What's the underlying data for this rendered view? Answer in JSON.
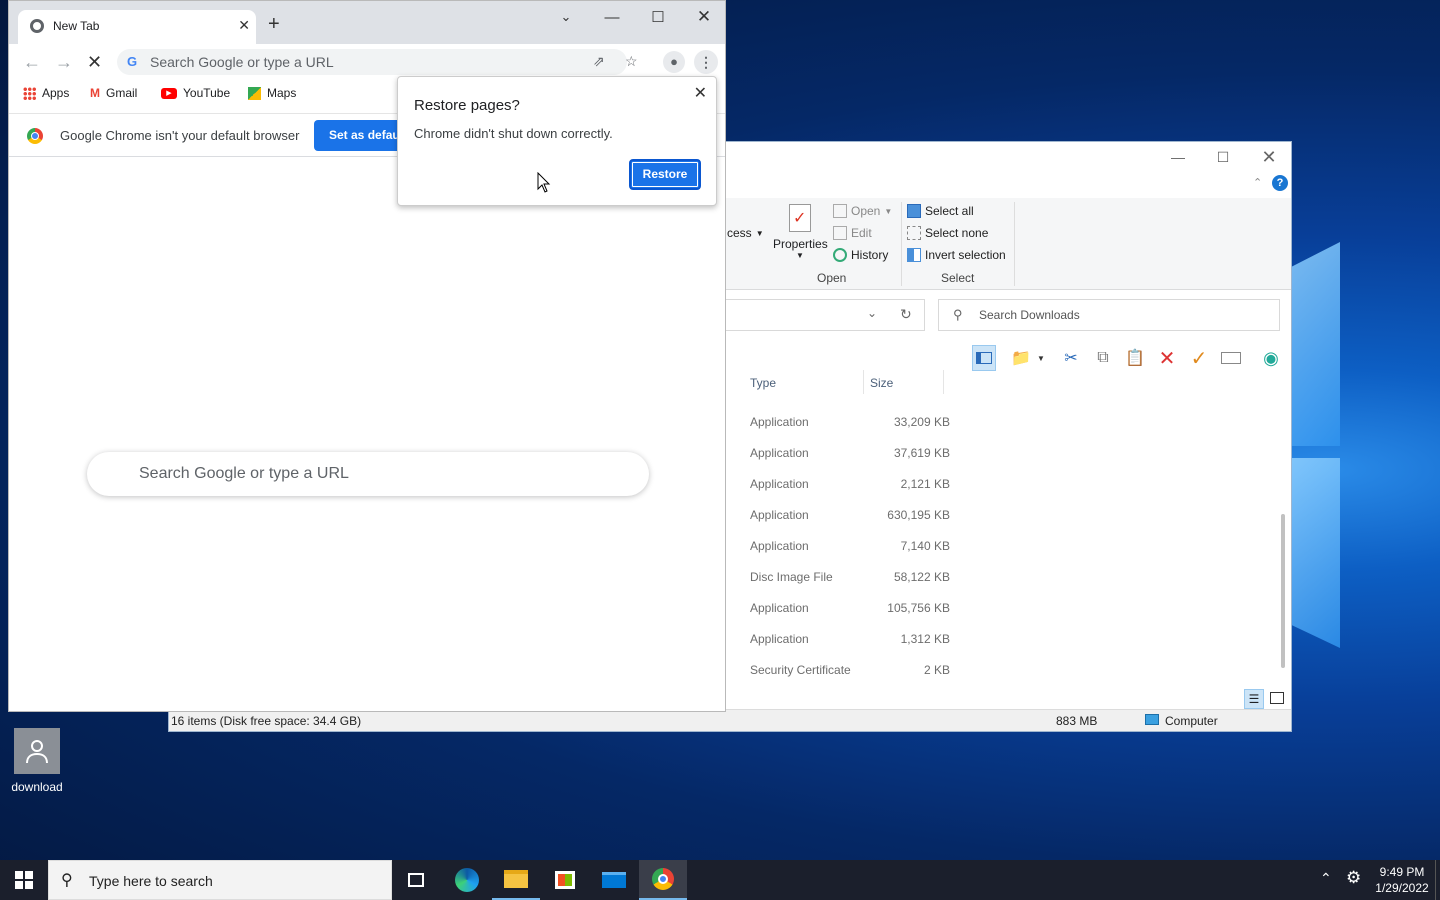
{
  "desktop": {
    "icon_label": "download"
  },
  "chrome": {
    "tab_title": "New Tab",
    "omnibox_placeholder": "Search Google or type a URL",
    "bookmarks": [
      "Apps",
      "Gmail",
      "YouTube",
      "Maps"
    ],
    "infobar_message": "Google Chrome isn't your default browser",
    "infobar_button": "Set as default",
    "ntp_search_placeholder": "Search Google or type a URL",
    "restore_dialog": {
      "title": "Restore pages?",
      "message": "Chrome didn't shut down correctly.",
      "button": "Restore"
    }
  },
  "explorer": {
    "ribbon": {
      "partial_access_label": "cess",
      "properties_label": "Properties",
      "open_label": "Open",
      "edit_label": "Edit",
      "history_label": "History",
      "open_group_label": "Open",
      "select_all_label": "Select all",
      "select_none_label": "Select none",
      "invert_selection_label": "Invert selection",
      "select_group_label": "Select"
    },
    "search_placeholder": "Search Downloads",
    "columns": {
      "type": "Type",
      "size": "Size"
    },
    "rows": [
      {
        "type": "Application",
        "size": "33,209 KB"
      },
      {
        "type": "Application",
        "size": "37,619 KB"
      },
      {
        "type": "Application",
        "size": "2,121 KB"
      },
      {
        "type": "Application",
        "size": "630,195 KB"
      },
      {
        "type": "Application",
        "size": "7,140 KB"
      },
      {
        "type": "Disc Image File",
        "size": "58,122 KB"
      },
      {
        "type": "Application",
        "size": "105,756 KB"
      },
      {
        "type": "Application",
        "size": "1,312 KB"
      },
      {
        "type": "Security Certificate",
        "size": "2 KB"
      }
    ],
    "status": {
      "items": "16 items (Disk free space: 34.4 GB)",
      "size": "883 MB",
      "location": "Computer"
    }
  },
  "taskbar": {
    "search_placeholder": "Type here to search",
    "time": "9:49 PM",
    "date": "1/29/2022"
  }
}
